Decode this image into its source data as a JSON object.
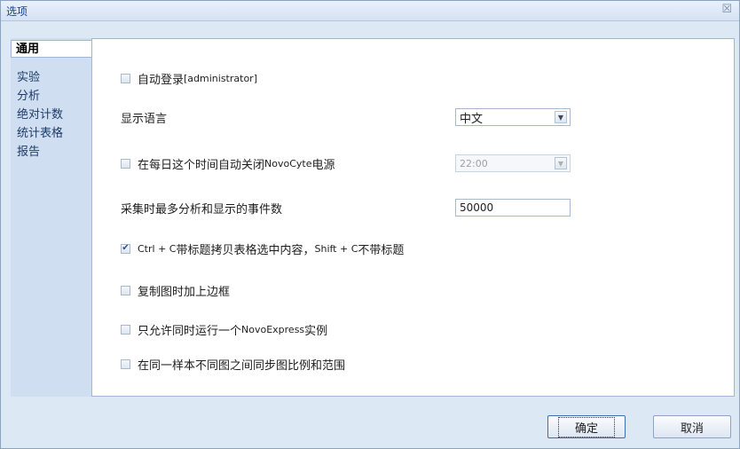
{
  "window": {
    "title": "选项",
    "close_glyph": "☒"
  },
  "nav": [
    {
      "label": "通用",
      "active": true
    },
    {
      "label": "实验"
    },
    {
      "label": "分析"
    },
    {
      "label": "绝对计数"
    },
    {
      "label": "统计表格"
    },
    {
      "label": "报告"
    }
  ],
  "general": {
    "auto_login": {
      "label": "自动登录 ",
      "user": "[administrator]",
      "checked": false
    },
    "language": {
      "label": "显示语言",
      "value": "中文"
    },
    "auto_shutdown": {
      "label_pre": "在每日这个时间自动关闭 ",
      "device": "NovoCyte",
      "label_post": " 电源",
      "checked": false,
      "time_value": "22:00"
    },
    "max_events": {
      "label": "采集时最多分析和显示的事件数",
      "value": "50000"
    },
    "copy_header": {
      "label_a": "Ctrl + C",
      "label_b": "带标题拷贝表格选中内容，",
      "label_c": "Shift + C",
      "label_d": "不带标题",
      "checked": true
    },
    "copy_border": {
      "label": "复制图时加上边框",
      "checked": false
    },
    "single_instance": {
      "label_pre": "只允许同时运行一个 ",
      "app": "NovoExpress",
      "label_post": " 实例",
      "checked": false
    },
    "sync_plots": {
      "label": "在同一样本不同图之间同步图比例和范围",
      "checked": false
    }
  },
  "buttons": {
    "ok": "确定",
    "cancel": "取消"
  },
  "icons": {
    "checkmark": "✔",
    "dropdown": "▼"
  }
}
